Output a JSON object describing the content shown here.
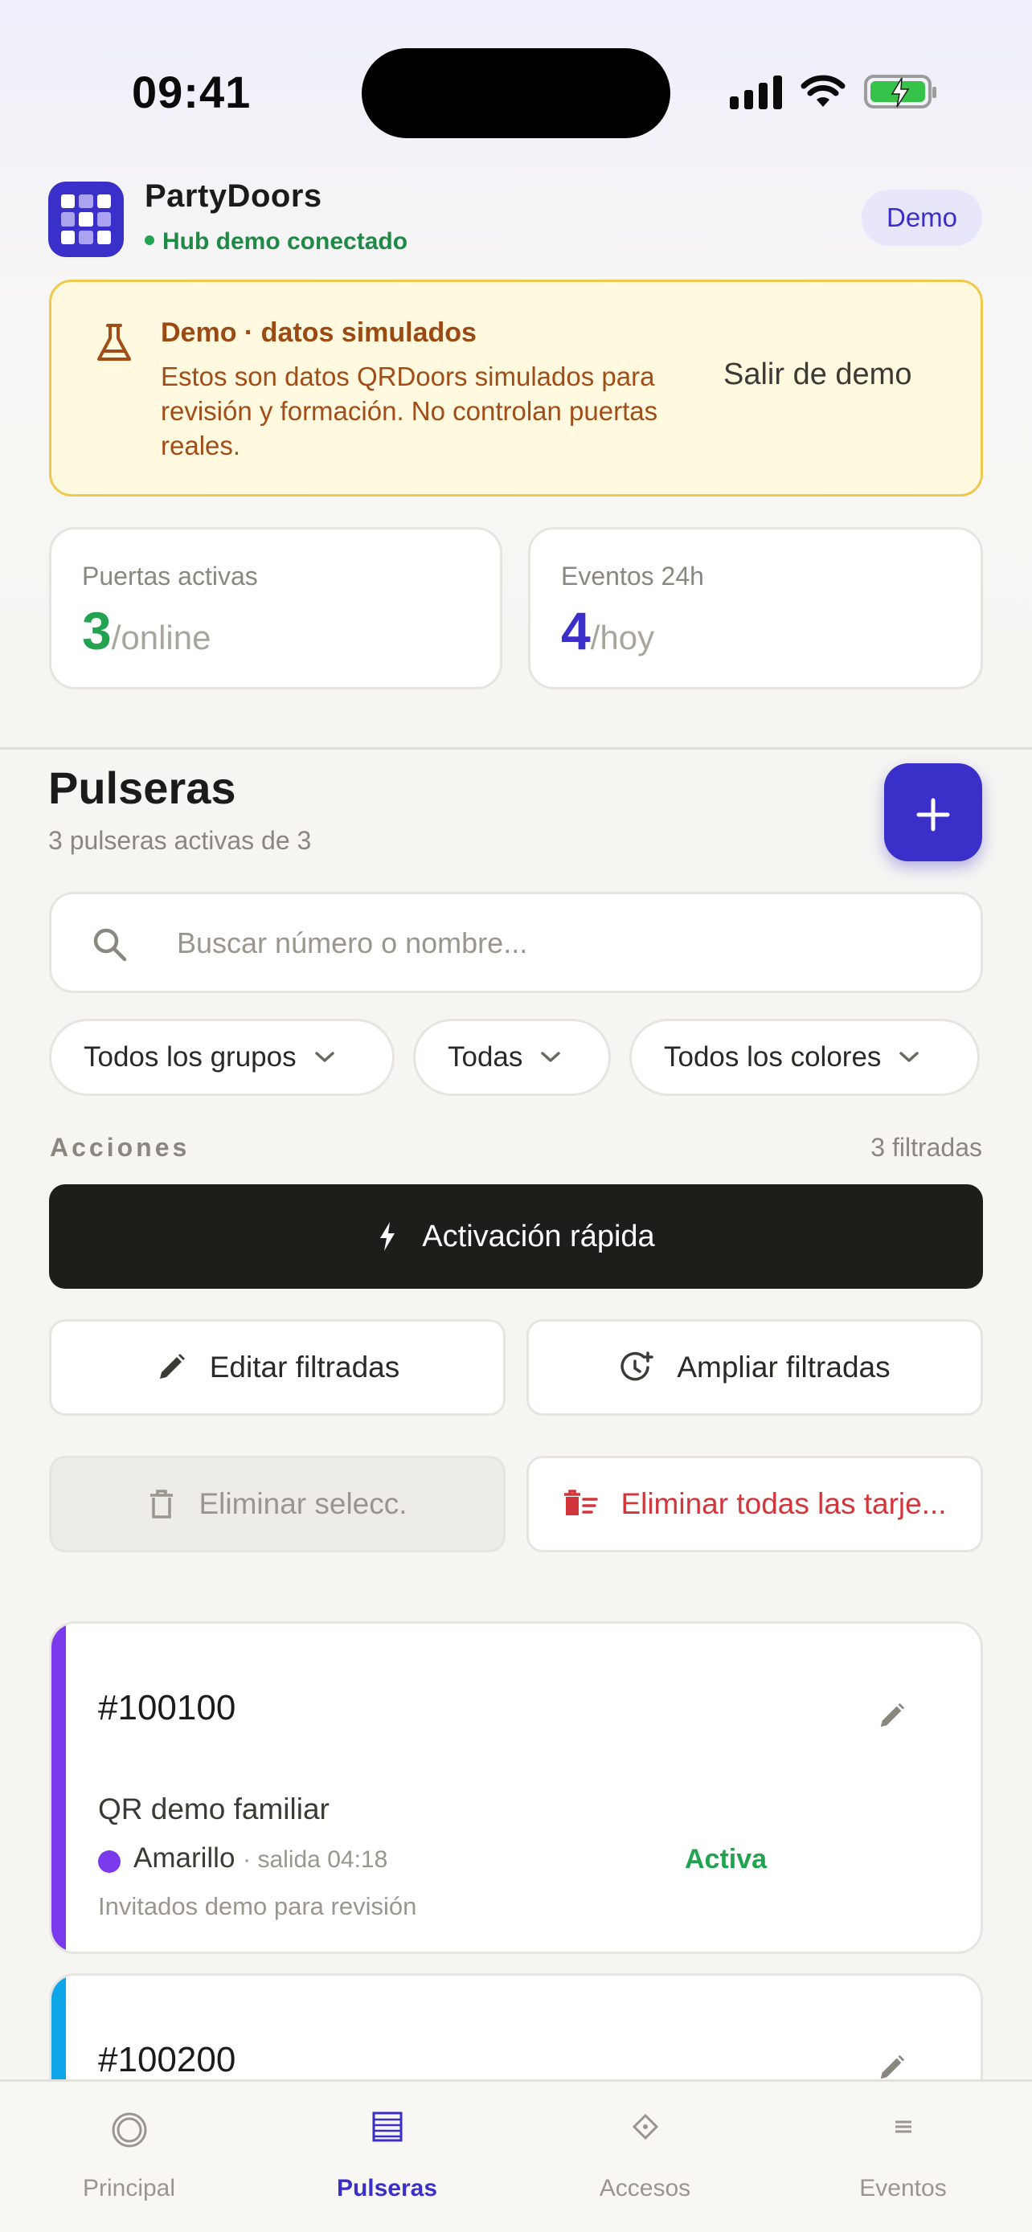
{
  "status_bar": {
    "time": "09:41"
  },
  "header": {
    "app_name": "PartyDoors",
    "hub_status": "Hub demo conectado",
    "badge": "Demo"
  },
  "demo_banner": {
    "title": "Demo · datos simulados",
    "text": "Estos son datos QRDoors simulados para revisión y formación. No controlan puertas reales.",
    "exit_label": "Salir de demo"
  },
  "stats": [
    {
      "label": "Puertas activas",
      "value": "3",
      "unit": "/online",
      "color": "#22a350"
    },
    {
      "label": "Eventos 24h",
      "value": "4",
      "unit": "/hoy",
      "color": "#3b2fc9"
    }
  ],
  "section": {
    "title": "Pulseras",
    "subtitle": "3 pulseras activas de 3"
  },
  "search": {
    "placeholder": "Buscar número o nombre..."
  },
  "filters": {
    "group": "Todos los grupos",
    "status": "Todas",
    "color": "Todos los colores"
  },
  "actions": {
    "label": "Acciones",
    "filtered_count": "3 filtradas",
    "quick_activation": "Activación rápida",
    "edit_filtered": "Editar filtradas",
    "extend_filtered": "Ampliar filtradas",
    "delete_selected": "Eliminar selecc.",
    "delete_all": "Eliminar todas las tarje..."
  },
  "wristbands": [
    {
      "number": "#100100",
      "name": "QR demo familiar",
      "color_name": "Amarillo",
      "color_dot": "#7c3aed",
      "accent": "#7c3aed",
      "exit": "· salida 04:18",
      "state": "Activa",
      "group": "Invitados demo para revisión"
    },
    {
      "number": "#100200",
      "accent": "#0ea5e9"
    }
  ],
  "tabbar": {
    "home": "Principal",
    "wristbands": "Pulseras",
    "access": "Accesos",
    "events": "Eventos"
  },
  "colors": {
    "brand": "#3b2fc9",
    "success": "#22a350",
    "danger": "#d2363a",
    "warning_bg": "#fff9df"
  }
}
